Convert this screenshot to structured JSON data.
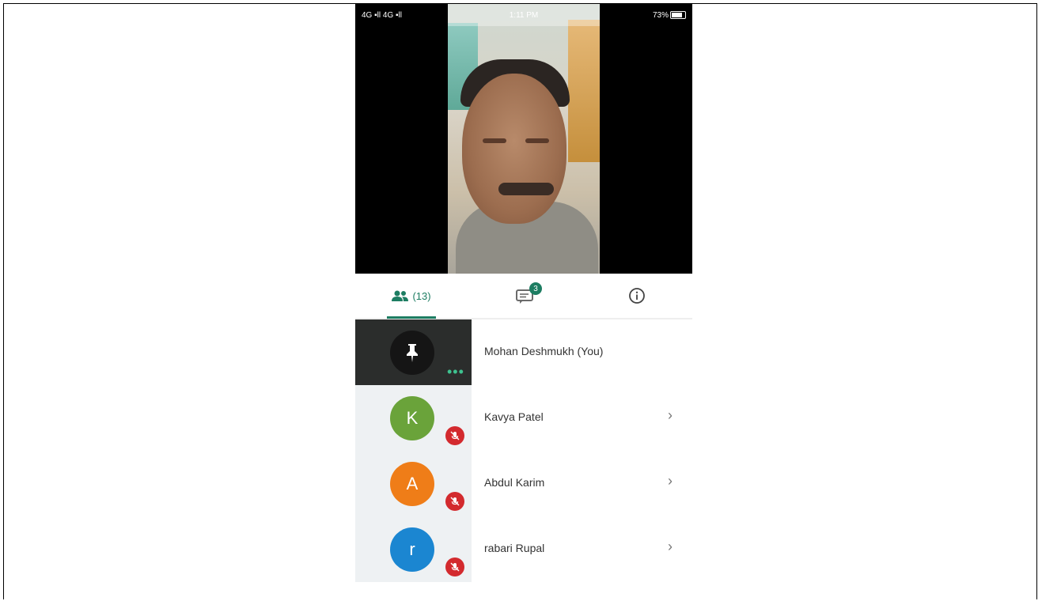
{
  "status_bar": {
    "left": "4G ▪ll 4G ▪ll",
    "time": "1:11 PM",
    "battery_text": "73%"
  },
  "tabs": {
    "participants_count": "(13)",
    "chat_badge": "3"
  },
  "participants": [
    {
      "name": "Mohan Deshmukh (You)",
      "initial": "",
      "color": "#151515",
      "is_you": true
    },
    {
      "name": "Kavya Patel",
      "initial": "K",
      "color": "#6aa33a",
      "is_you": false
    },
    {
      "name": "Abdul Karim",
      "initial": "A",
      "color": "#ef7d18",
      "is_you": false
    },
    {
      "name": "rabari Rupal",
      "initial": "r",
      "color": "#1b86d1",
      "is_you": false
    }
  ],
  "colors": {
    "accent": "#1d7d62",
    "muted_red": "#d32a2e"
  }
}
